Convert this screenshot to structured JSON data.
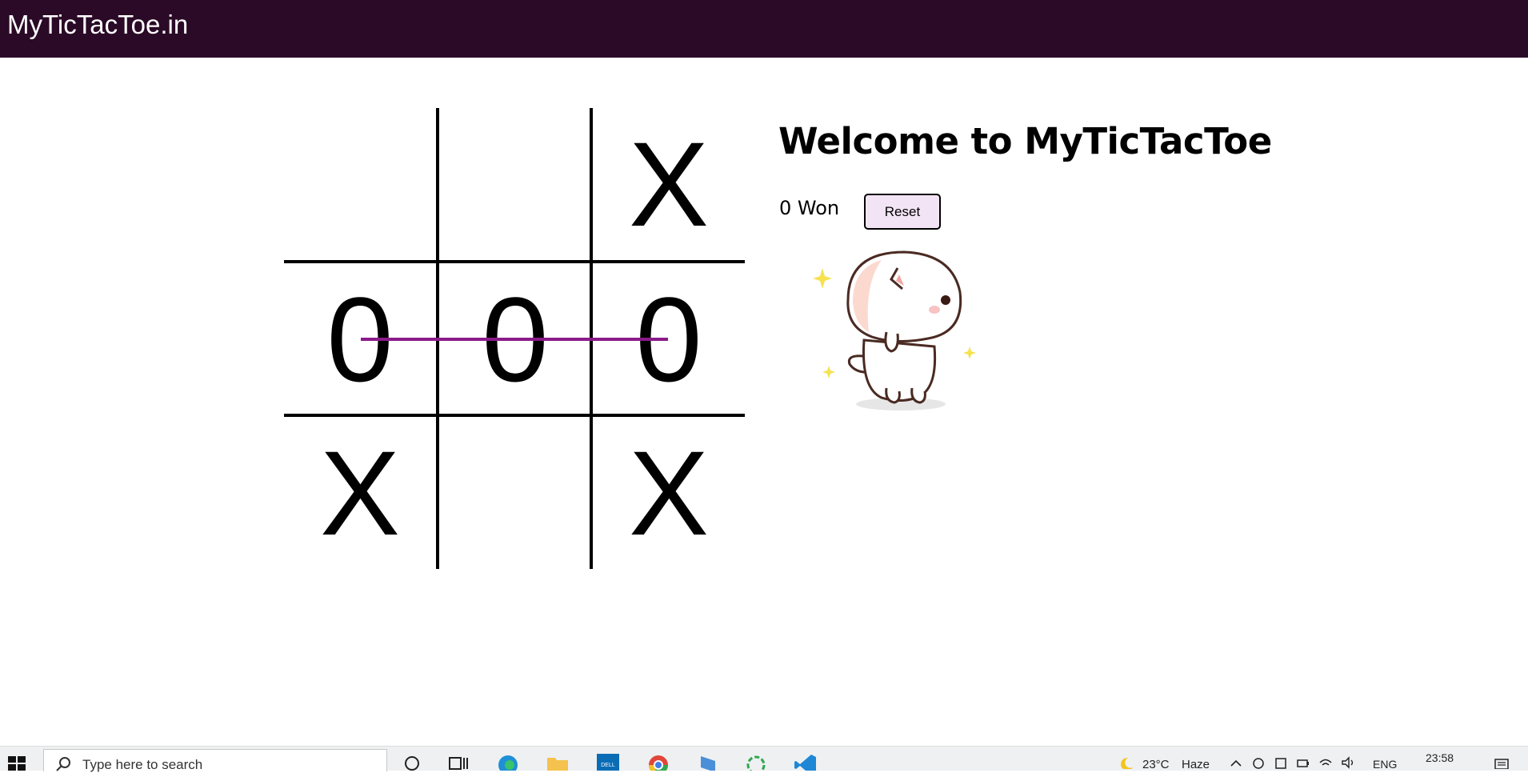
{
  "navbar": {
    "brand": "MyTicTacToe.in"
  },
  "board": {
    "cells": [
      "",
      "",
      "X",
      "0",
      "0",
      "0",
      "X",
      "",
      "X"
    ],
    "winning_row": "middle",
    "win_line_color": "#8b1a8b"
  },
  "info": {
    "title": "Welcome to MyTicTacToe",
    "won_text": "0 Won",
    "reset_label": "Reset"
  },
  "colors": {
    "navbar_bg": "#2a0a26",
    "reset_bg": "#f3e4f5"
  },
  "taskbar": {
    "search_placeholder": "Type here to search",
    "pinned_icons": [
      "cortana-icon",
      "task-view-icon",
      "edge-icon",
      "file-explorer-icon",
      "dell-icon",
      "chrome-icon",
      "app-icon",
      "refresh-app-icon",
      "vscode-icon"
    ],
    "weather": {
      "temp": "23°C",
      "condition": "Haze"
    },
    "language": "ENG",
    "time": "23:58"
  }
}
